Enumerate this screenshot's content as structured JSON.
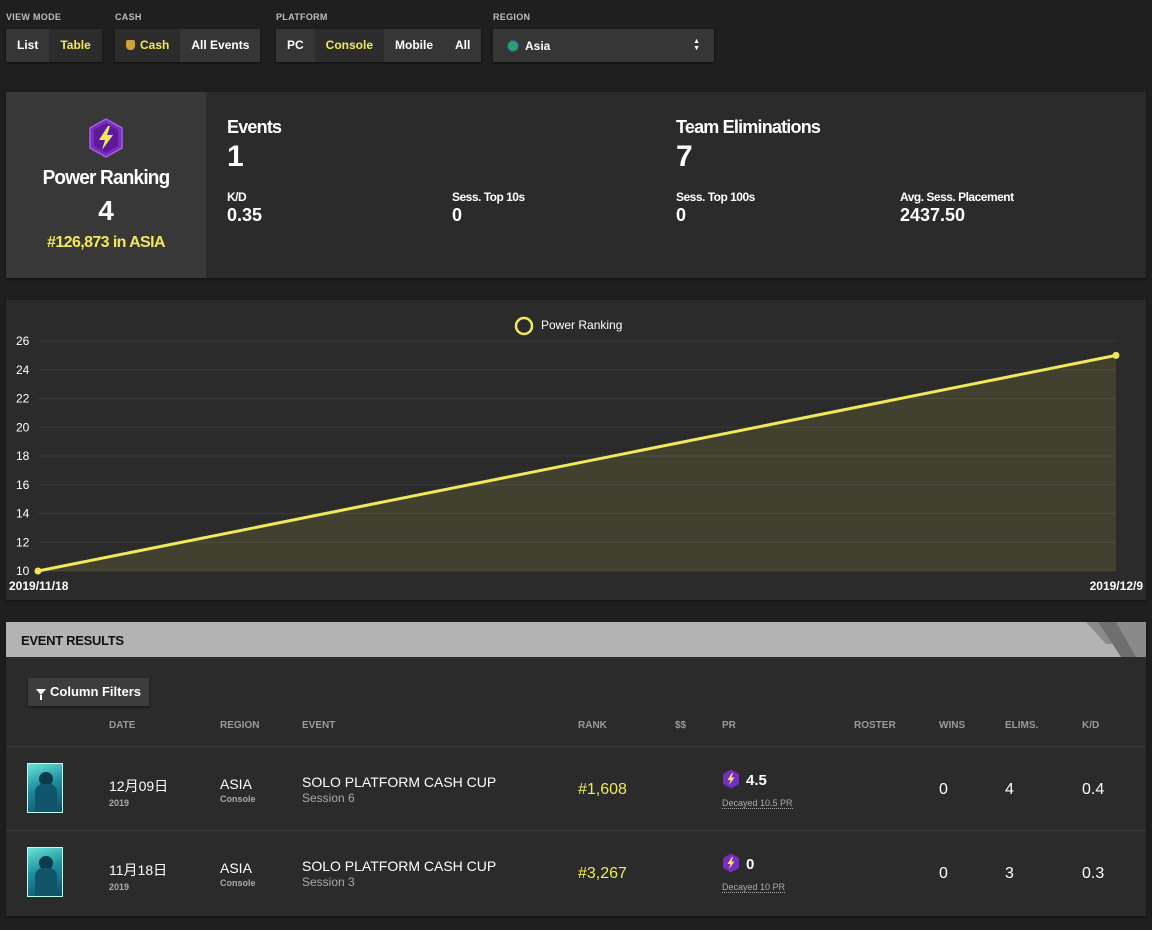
{
  "filters": {
    "view_mode": {
      "label": "VIEW MODE",
      "options": [
        "List",
        "Table"
      ],
      "active": "Table"
    },
    "cash": {
      "label": "CASH",
      "options": [
        "Cash",
        "All Events"
      ],
      "active": "Cash"
    },
    "platform": {
      "label": "PLATFORM",
      "options": [
        "PC",
        "Console",
        "Mobile",
        "All"
      ],
      "active": "Console"
    },
    "region": {
      "label": "REGION",
      "value": "Asia"
    }
  },
  "stats": {
    "power_ranking": {
      "title": "Power Ranking",
      "value": "4",
      "rank_text": "#126,873 in ASIA"
    },
    "events": {
      "label": "Events",
      "value": "1"
    },
    "team_eliminations": {
      "label": "Team Eliminations",
      "value": "7"
    },
    "kd": {
      "label": "K/D",
      "value": "0.35"
    },
    "sess_top10": {
      "label": "Sess. Top 10s",
      "value": "0"
    },
    "sess_top100": {
      "label": "Sess. Top 100s",
      "value": "0"
    },
    "avg_placement": {
      "label": "Avg. Sess. Placement",
      "value": "2437.50"
    }
  },
  "chart_data": {
    "type": "area",
    "legend": "Power Ranking",
    "legend_position": "top-center",
    "x": [
      "2019/11/18",
      "2019/12/9"
    ],
    "series": [
      {
        "name": "Power Ranking",
        "values": [
          10,
          25
        ]
      }
    ],
    "ylim": [
      10,
      26
    ],
    "yticks": [
      10,
      12,
      14,
      16,
      18,
      20,
      22,
      24,
      26
    ],
    "grid": true,
    "color": "#f2e85a"
  },
  "results": {
    "title": "EVENT RESULTS",
    "filters_button": "Column Filters",
    "columns": [
      "DATE",
      "REGION",
      "EVENT",
      "RANK",
      "$$",
      "PR",
      "ROSTER",
      "WINS",
      "ELIMS.",
      "K/D"
    ],
    "rows": [
      {
        "date": "12月09日",
        "year": "2019",
        "region": "ASIA",
        "platform": "Console",
        "event": "SOLO PLATFORM CASH CUP",
        "session": "Session 6",
        "rank": "#1,608",
        "pr": "4.5",
        "decayed": "Decayed 10.5 PR",
        "wins": "0",
        "elims": "4",
        "kd": "0.4"
      },
      {
        "date": "11月18日",
        "year": "2019",
        "region": "ASIA",
        "platform": "Console",
        "event": "SOLO PLATFORM CASH CUP",
        "session": "Session 3",
        "rank": "#3,267",
        "pr": "0",
        "decayed": "Decayed 10 PR",
        "wins": "0",
        "elims": "3",
        "kd": "0.3"
      }
    ]
  }
}
